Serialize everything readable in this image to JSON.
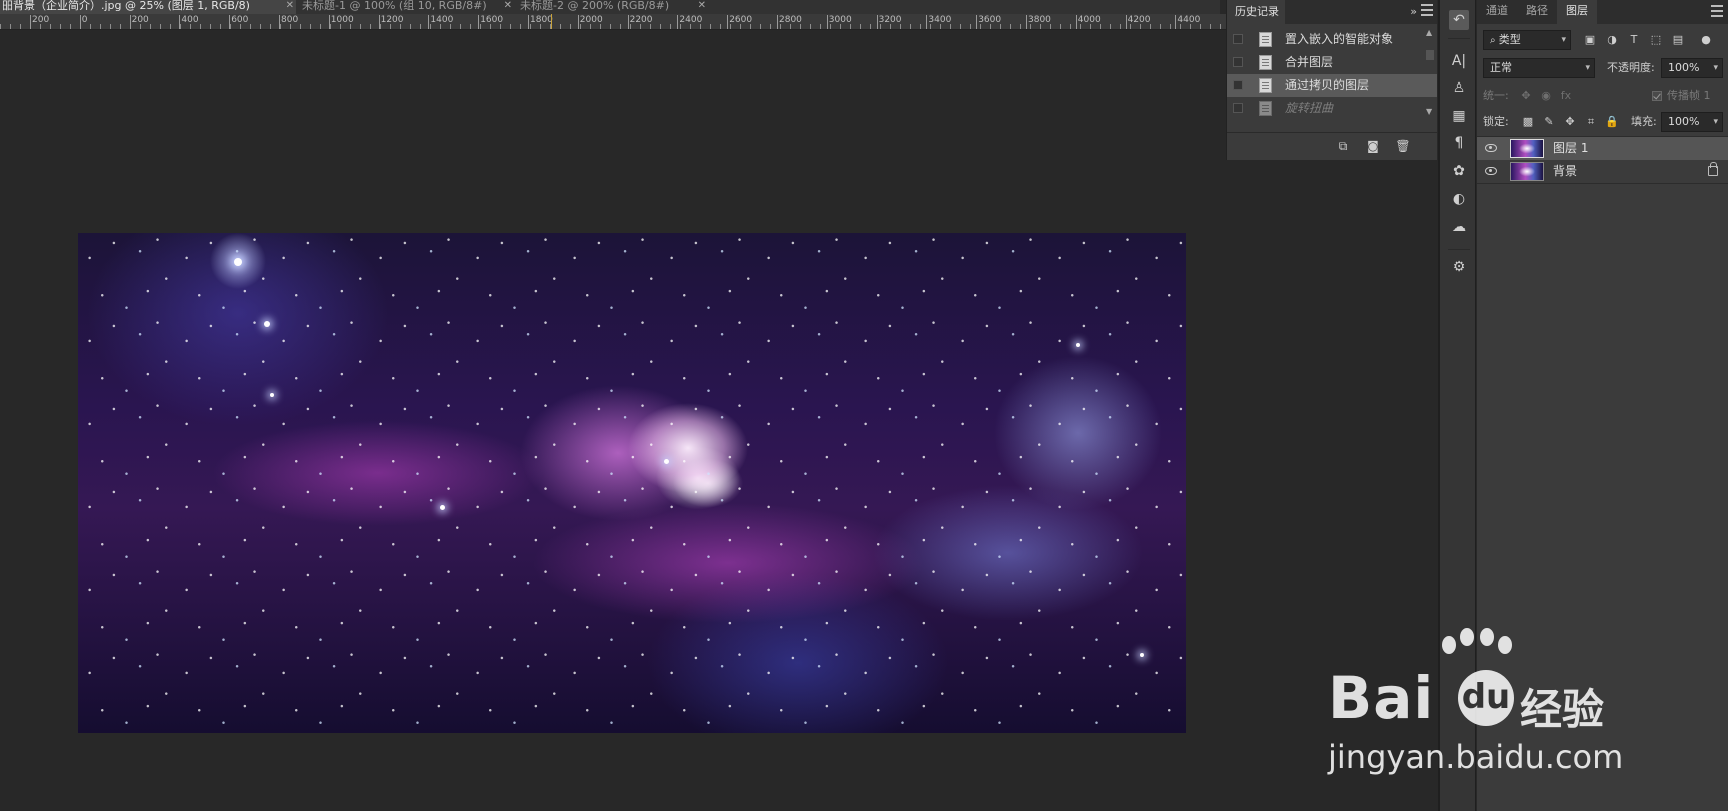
{
  "document_tabs": [
    {
      "label": "昍背景（企业简介）.jpg @ 25% (图层 1, RGB/8)",
      "active": true
    },
    {
      "label": "未标题-1 @ 100% (组 10, RGB/8#)",
      "active": false
    },
    {
      "label": "未标题-2 @ 200% (RGB/8#)",
      "active": false
    }
  ],
  "ruler": {
    "labels": [
      "200",
      "0",
      "200",
      "400",
      "600",
      "800",
      "1000",
      "1200",
      "1400",
      "1600",
      "1800",
      "2000",
      "2200",
      "2400",
      "2600",
      "2800",
      "3000",
      "3200",
      "3400",
      "3600",
      "3800",
      "4000",
      "4200",
      "4400"
    ]
  },
  "history_panel": {
    "title": "历史记录",
    "items": [
      {
        "label": "置入嵌入的智能对象",
        "selected": false,
        "dimmed": false
      },
      {
        "label": "合并图层",
        "selected": false,
        "dimmed": false
      },
      {
        "label": "通过拷贝的图层",
        "selected": true,
        "dimmed": false
      },
      {
        "label": "旋转扭曲",
        "selected": false,
        "dimmed": true
      }
    ],
    "footer_icons": [
      "new-document-from-state-icon",
      "camera-snapshot-icon",
      "trash-icon"
    ]
  },
  "tool_strip": {
    "icons": [
      "history-brush-icon",
      "character-icon",
      "stamp-icon",
      "grid-icon",
      "paragraph-icon",
      "palette-icon",
      "adjustment-icon",
      "cc-libraries-icon",
      "plugin-icon"
    ]
  },
  "layers_panel": {
    "tabs": [
      {
        "label": "通道",
        "active": false
      },
      {
        "label": "路径",
        "active": false
      },
      {
        "label": "图层",
        "active": true
      }
    ],
    "filter_kind": "类型",
    "blend_mode": "正常",
    "opacity_label": "不透明度:",
    "opacity_value": "100%",
    "unify_label": "统一:",
    "propagate_label": "传播帧 1",
    "lock_label": "锁定:",
    "fill_label": "填充:",
    "fill_value": "100%",
    "layers": [
      {
        "name": "图层 1",
        "selected": true,
        "visible": true,
        "locked": false
      },
      {
        "name": "背景",
        "selected": false,
        "visible": true,
        "locked": true
      }
    ]
  },
  "watermark": {
    "brand": "Bai",
    "brand_du": "du",
    "brand_cn": "经验",
    "url": "jingyan.baidu.com"
  }
}
